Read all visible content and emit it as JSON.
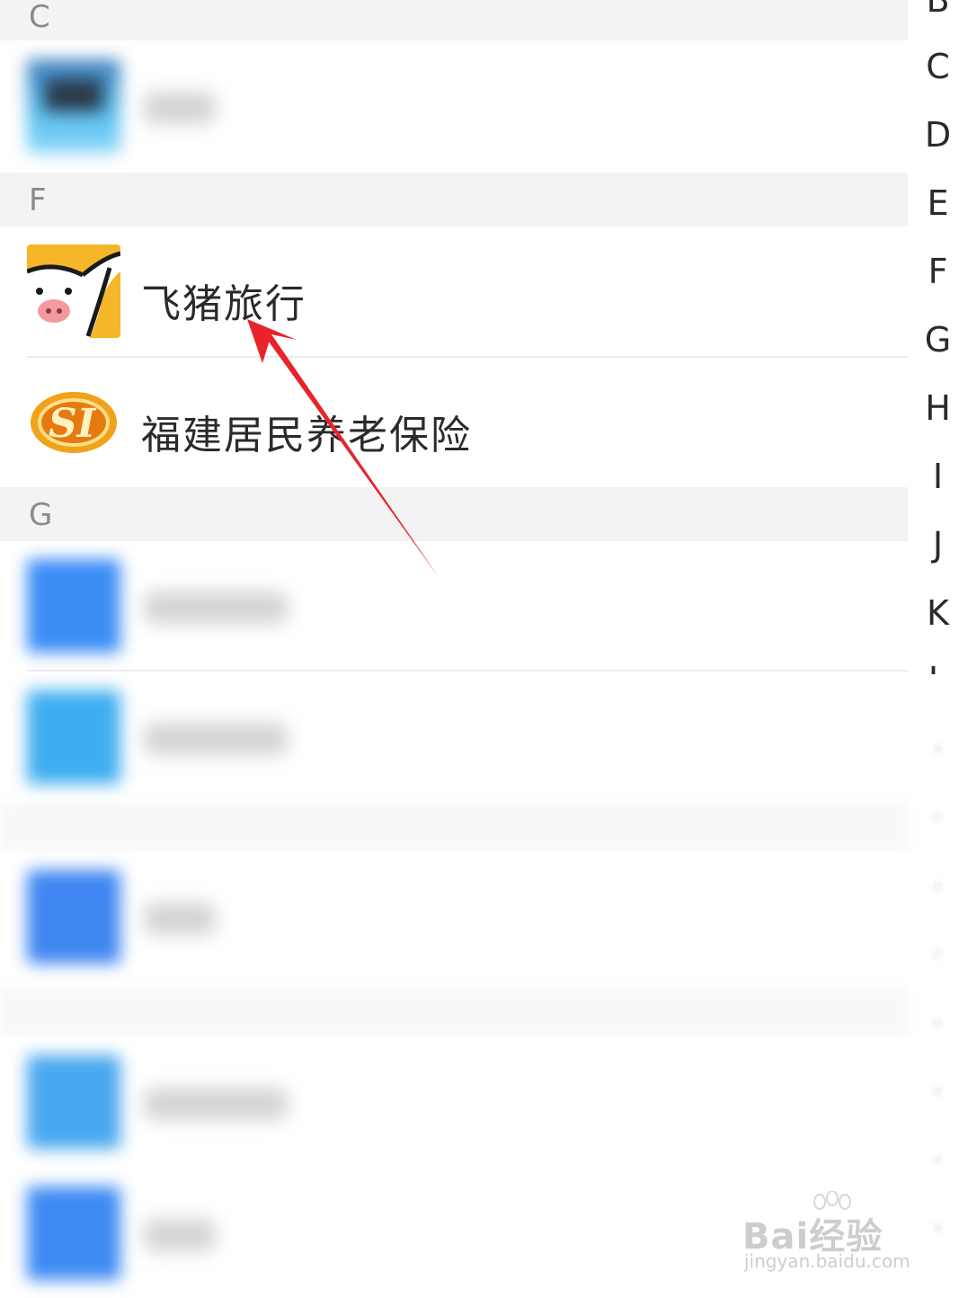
{
  "sections": [
    {
      "letter": "C"
    },
    {
      "letter": "F"
    },
    {
      "letter": "G"
    }
  ],
  "apps": {
    "feizhu": {
      "name": "飞猪旅行",
      "icon": "feizhu-pig-icon",
      "icon_bg": "#f5b62a"
    },
    "fujian_pension": {
      "name": "福建居民养老保险",
      "icon": "social-insurance-si-icon",
      "icon_color": "#e08a12"
    }
  },
  "index_bar": {
    "letters": [
      "B",
      "C",
      "D",
      "E",
      "F",
      "G",
      "H",
      "I",
      "J",
      "K",
      "L"
    ]
  },
  "annotation": {
    "arrow_color": "#e8232a"
  },
  "watermark": {
    "brand": "Bai经验",
    "url": "jingyan.baidu.com"
  }
}
